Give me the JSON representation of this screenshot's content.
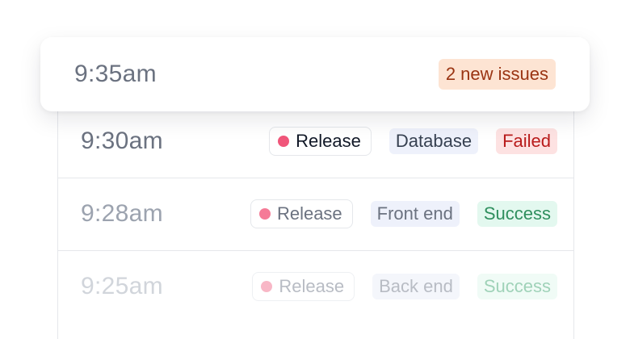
{
  "header_card": {
    "time": "9:35am",
    "issues_badge": "2 new issues"
  },
  "rows": [
    {
      "time": "9:30am",
      "release_label": "Release",
      "category": "Database",
      "status": "Failed",
      "status_kind": "failed"
    },
    {
      "time": "9:28am",
      "release_label": "Release",
      "category": "Front end",
      "status": "Success",
      "status_kind": "success"
    },
    {
      "time": "9:25am",
      "release_label": "Release",
      "category": "Back end",
      "status": "Success",
      "status_kind": "success"
    }
  ],
  "colors": {
    "release_dot": "#f0567a",
    "failed_bg": "#fde2e2",
    "failed_text": "#b91c1c",
    "success_bg": "#e3f8ef",
    "success_text": "#15803d",
    "issues_bg": "#fde4d3",
    "issues_text": "#9a3412"
  },
  "icons": {
    "release_dot": "status-dot-icon"
  }
}
